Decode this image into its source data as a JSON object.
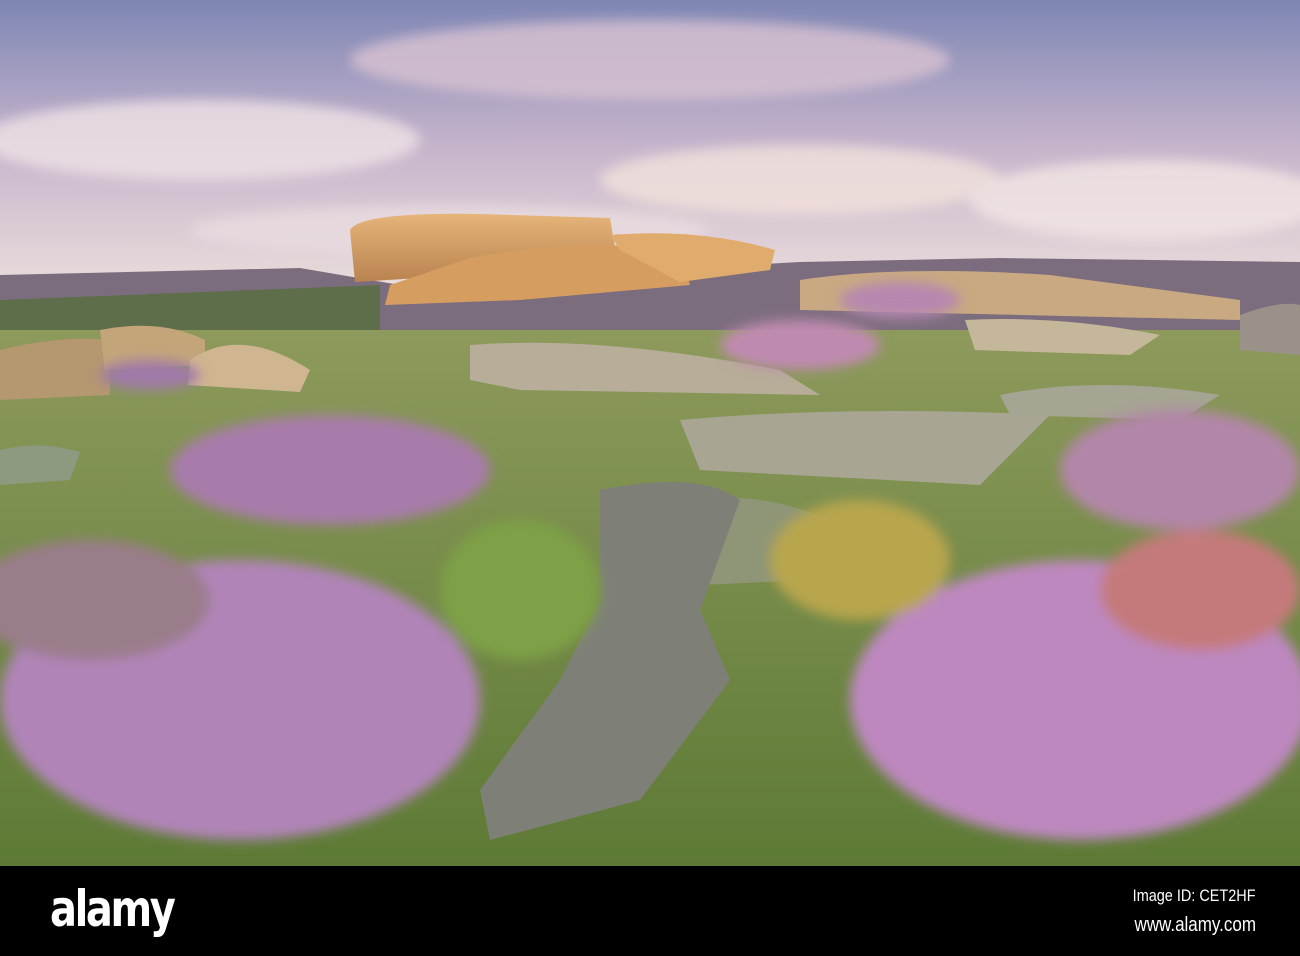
{
  "watermark": {
    "logo_text": "alamy",
    "image_id": "Image ID: CET2HF",
    "url": "www.alamy.com"
  },
  "colors": {
    "sky_top": "#8a8fb8",
    "sky_horizon": "#e7d3d6",
    "rock": "#d9a56a",
    "heather": "#b784c4",
    "grass": "#7ea445",
    "footer": "#000000"
  }
}
